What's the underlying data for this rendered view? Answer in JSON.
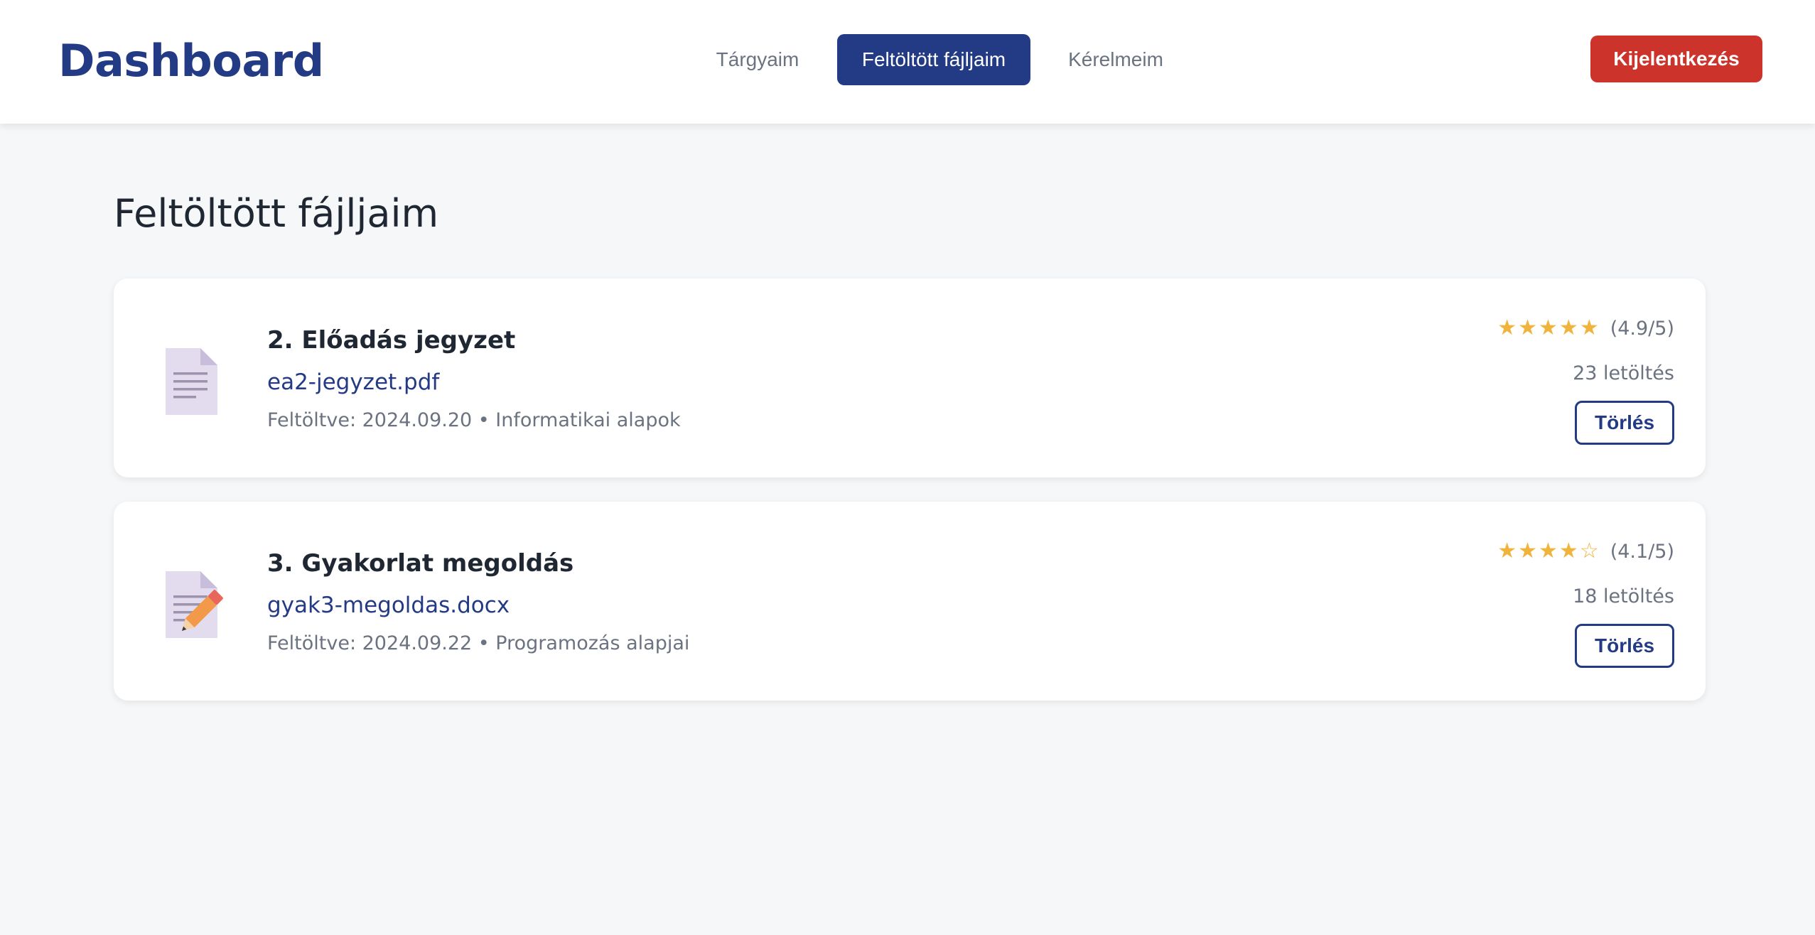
{
  "header": {
    "brand": "Dashboard",
    "tabs": [
      {
        "label": "Tárgyaim",
        "active": false
      },
      {
        "label": "Feltöltött fájljaim",
        "active": true
      },
      {
        "label": "Kérelmeim",
        "active": false
      }
    ],
    "logout_label": "Kijelentkezés"
  },
  "main": {
    "title": "Feltöltött fájljaim",
    "files": [
      {
        "icon": "document-icon",
        "title": "2. Előadás jegyzet",
        "filename": "ea2-jegyzet.pdf",
        "meta": "Feltöltve: 2024.09.20 • Informatikai alapok",
        "stars": "★★★★★",
        "rating": "(4.9/5)",
        "downloads": "23 letöltés",
        "delete_label": "Törlés"
      },
      {
        "icon": "document-edit-icon",
        "title": "3. Gyakorlat megoldás",
        "filename": "gyak3-megoldas.docx",
        "meta": "Feltöltve: 2024.09.22 • Programozás alapjai",
        "stars": "★★★★☆",
        "rating": "(4.1/5)",
        "downloads": "18 letöltés",
        "delete_label": "Törlés"
      }
    ]
  },
  "colors": {
    "brand": "#233a85",
    "danger": "#cc342b",
    "star": "#f0b43c",
    "background": "#f6f7f9"
  }
}
